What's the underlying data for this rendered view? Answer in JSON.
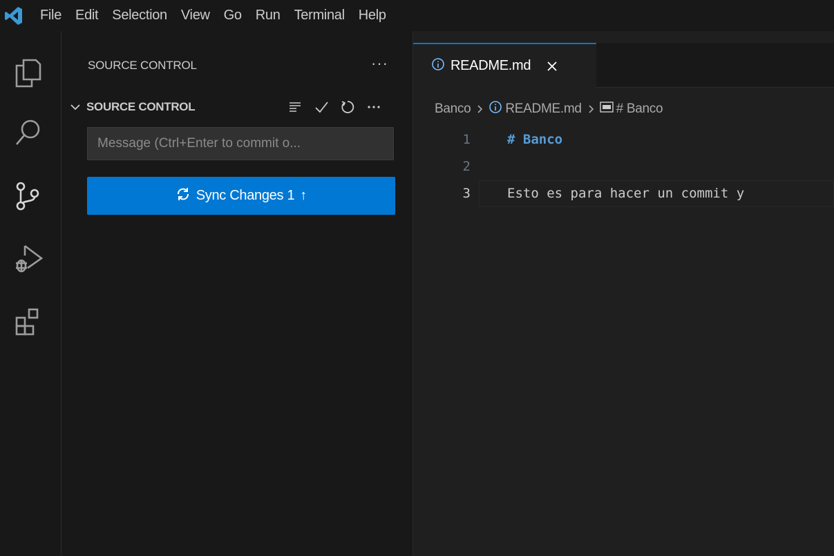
{
  "menubar": {
    "items": [
      "File",
      "Edit",
      "Selection",
      "View",
      "Go",
      "Run",
      "Terminal",
      "Help"
    ]
  },
  "activitybar": {
    "icons": [
      "explorer-icon",
      "search-icon",
      "source-control-icon",
      "run-debug-icon",
      "extensions-icon"
    ]
  },
  "sidebar": {
    "title": "SOURCE CONTROL",
    "more_label": "···",
    "section": {
      "label": "SOURCE CONTROL",
      "actions": [
        "view-as-list-icon",
        "commit-check-icon",
        "refresh-icon",
        "more-actions-icon"
      ]
    },
    "commit_placeholder": "Message (Ctrl+Enter to commit o...",
    "sync_button": {
      "label": "Sync Changes 1",
      "icon": "sync-icon",
      "arrow": "↑"
    }
  },
  "editor": {
    "tab": {
      "label": "README.md",
      "icon": "info-icon",
      "close_icon": "close-icon"
    },
    "breadcrumb": {
      "folder": "Banco",
      "file": "README.md",
      "symbol": "# Banco"
    },
    "lines": [
      {
        "number": "1",
        "text": "# Banco",
        "kind": "heading"
      },
      {
        "number": "2",
        "text": "",
        "kind": "blank"
      },
      {
        "number": "3",
        "text": "Esto es para hacer un commit y",
        "kind": "text"
      }
    ]
  },
  "colors": {
    "accent": "#0078d4",
    "heading": "#569cd6",
    "background": "#1f1f1f",
    "sidebar": "#181818",
    "logo": "#3c99d4"
  }
}
